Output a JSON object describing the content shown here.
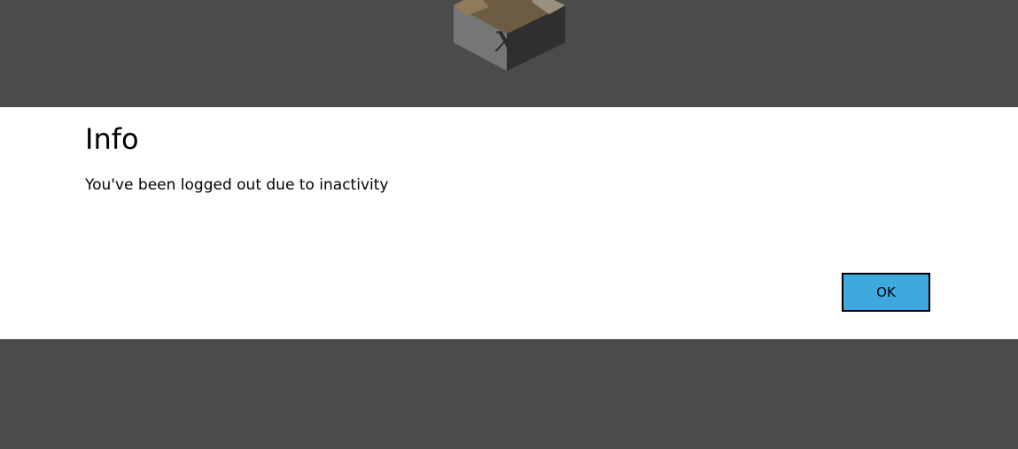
{
  "dialog": {
    "title": "Info",
    "message": "You've been logged out due to inactivity",
    "ok_label": "OK"
  },
  "colors": {
    "backdrop": "#4b4b4b",
    "dialog_background": "#ffffff",
    "button_accent": "#3fa9df"
  },
  "icons": {
    "app_logo": "cube-logo-icon"
  }
}
